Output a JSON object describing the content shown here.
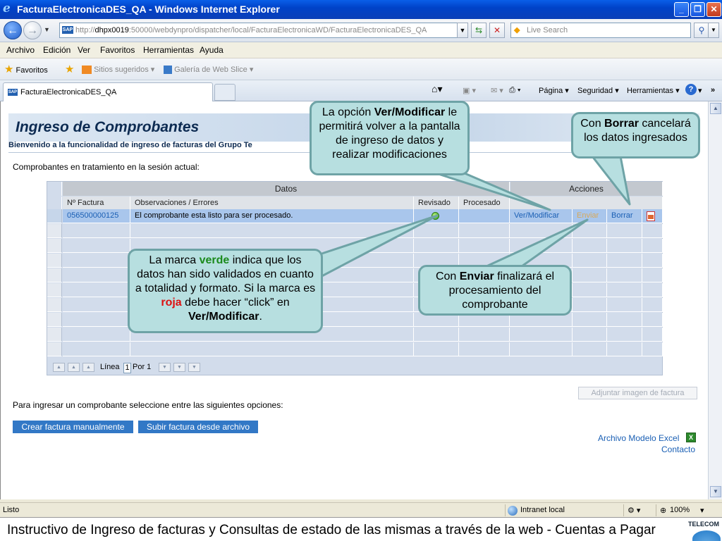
{
  "window": {
    "title": "FacturaElectronicaDES_QA - Windows Internet Explorer",
    "controls": [
      "minimize",
      "maximize",
      "close"
    ]
  },
  "address_bar": {
    "url_prefix": "http://",
    "url_host": "dhpx0019",
    "url_rest": ":50000/webdynpro/dispatcher/local/FacturaElectronicaWD/FacturaElectronicaDES_QA",
    "search_placeholder": "Live Search"
  },
  "menu": [
    "Archivo",
    "Edición",
    "Ver",
    "Favoritos",
    "Herramientas",
    "Ayuda"
  ],
  "favorites_bar": {
    "favorites_label": "Favoritos",
    "items": [
      "Sitios sugeridos ▾",
      "Galería de Web Slice ▾"
    ]
  },
  "tabs": [
    {
      "label": "FacturaElectronicaDES_QA"
    }
  ],
  "command_bar": [
    "Página ▾",
    "Seguridad ▾",
    "Herramientas ▾"
  ],
  "page": {
    "title": "Ingreso de Comprobantes",
    "welcome": "Bienvenido a la funcionalidad de ingreso de facturas del Grupo Te",
    "subtitle": "Comprobantes en tratamiento en la sesión actual:",
    "instructions": "Para ingresar un comprobante seleccione entre las siguientes opciones:",
    "attach_button": "Adjuntar imagen de factura",
    "create_button": "Crear factura manualmente",
    "upload_button": "Subir factura desde archivo",
    "excel_link": "Archivo Modelo Excel",
    "contact_link": "Contacto"
  },
  "table": {
    "group_headers": [
      "Datos",
      "Acciones"
    ],
    "columns": [
      "Nº Factura",
      "Observaciones / Errores",
      "Revisado",
      "Procesado"
    ],
    "rows": [
      {
        "invoice": "056500000125",
        "observations": "El comprobante esta listo para ser procesado.",
        "reviewed": "green",
        "processed": "",
        "actions": [
          "Ver/Modificar",
          "Enviar",
          "Borrar"
        ]
      }
    ],
    "empty_rows": 9,
    "pager": {
      "line_label": "Línea",
      "line_value": "1",
      "of_label": "Por 1"
    }
  },
  "callouts": {
    "ver_pre": "La opción ",
    "ver_b1": "Ver",
    "ver_mid": "/",
    "ver_b2": "Modificar",
    "ver_post": "le permitirá volver a la pantalla de ingreso de datos y realizar modificaciones",
    "borrar_pre": "Con ",
    "borrar_b": "Borrar",
    "borrar_post": "cancelará los datos ingresados",
    "green_pre": "La marca ",
    "green_word": "verde",
    "green_mid": " indica que los datos han sido validados en cuanto a totalidad y formato.",
    "green_pre2": "Si la marca es ",
    "red_word": "roja",
    "green_mid2": " debe hacer “click” en ",
    "green_b1": "Ver",
    "green_slash": "/",
    "green_b2": "Modificar",
    "green_end": ".",
    "enviar_pre": "Con ",
    "enviar_b": "Enviar",
    "enviar_post": " finalizará el procesamiento del comprobante"
  },
  "status_bar": {
    "left": "Listo",
    "zone": "Intranet local",
    "zoom": "100%"
  },
  "footer": {
    "caption": "Instructivo de Ingreso de facturas y Consultas de estado de las mismas a través de la web    -    Cuentas a Pagar",
    "logo": "TELECOM"
  },
  "colors": {
    "title_bar": "#0a5fe8",
    "callout_fill": "#b7dfe0",
    "callout_border": "#6ea3a6",
    "selected_row": "#a9c6ec",
    "button_blue": "#3278c6"
  }
}
